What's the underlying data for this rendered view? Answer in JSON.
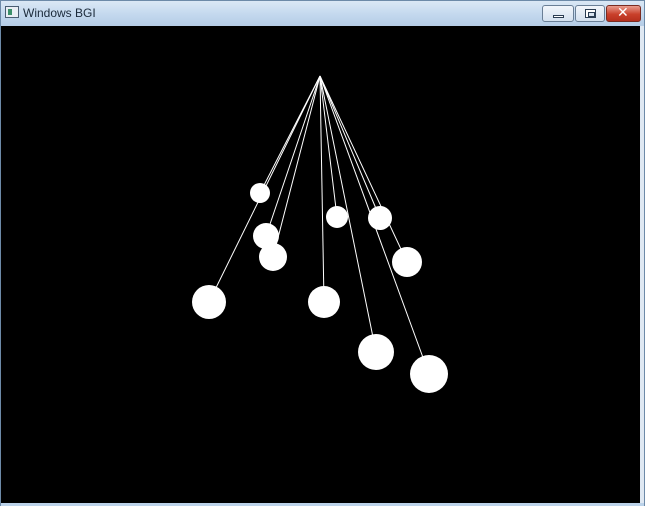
{
  "window": {
    "title": "Windows BGI",
    "app_icon": "bgi-window-icon",
    "controls": {
      "minimize_icon": "minimize-icon",
      "maximize_icon": "restore-icon",
      "close_icon": "close-icon",
      "close_glyph": "✕"
    },
    "colors": {
      "canvas_background": "#000000",
      "drawing": "#ffffff",
      "title_text": "#1b2a3a",
      "close_button": "#c9402b"
    }
  }
}
